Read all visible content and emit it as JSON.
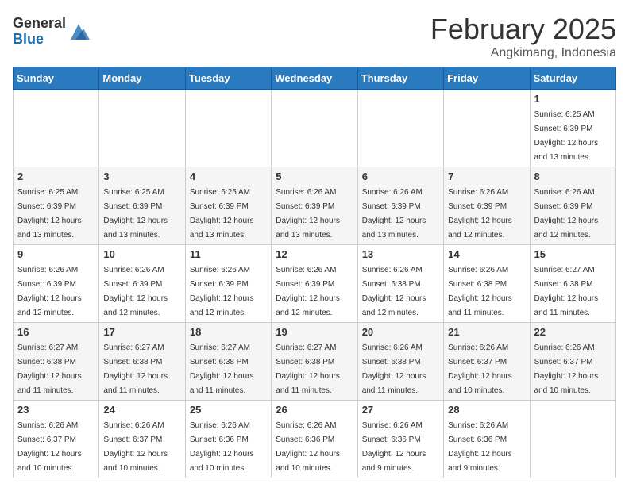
{
  "header": {
    "logo_general": "General",
    "logo_blue": "Blue",
    "month_title": "February 2025",
    "location": "Angkimang, Indonesia"
  },
  "days_of_week": [
    "Sunday",
    "Monday",
    "Tuesday",
    "Wednesday",
    "Thursday",
    "Friday",
    "Saturday"
  ],
  "weeks": [
    [
      {
        "day": "",
        "sunrise": "",
        "sunset": "",
        "daylight": ""
      },
      {
        "day": "",
        "sunrise": "",
        "sunset": "",
        "daylight": ""
      },
      {
        "day": "",
        "sunrise": "",
        "sunset": "",
        "daylight": ""
      },
      {
        "day": "",
        "sunrise": "",
        "sunset": "",
        "daylight": ""
      },
      {
        "day": "",
        "sunrise": "",
        "sunset": "",
        "daylight": ""
      },
      {
        "day": "",
        "sunrise": "",
        "sunset": "",
        "daylight": ""
      },
      {
        "day": "1",
        "sunrise": "Sunrise: 6:25 AM",
        "sunset": "Sunset: 6:39 PM",
        "daylight": "Daylight: 12 hours and 13 minutes."
      }
    ],
    [
      {
        "day": "2",
        "sunrise": "Sunrise: 6:25 AM",
        "sunset": "Sunset: 6:39 PM",
        "daylight": "Daylight: 12 hours and 13 minutes."
      },
      {
        "day": "3",
        "sunrise": "Sunrise: 6:25 AM",
        "sunset": "Sunset: 6:39 PM",
        "daylight": "Daylight: 12 hours and 13 minutes."
      },
      {
        "day": "4",
        "sunrise": "Sunrise: 6:25 AM",
        "sunset": "Sunset: 6:39 PM",
        "daylight": "Daylight: 12 hours and 13 minutes."
      },
      {
        "day": "5",
        "sunrise": "Sunrise: 6:26 AM",
        "sunset": "Sunset: 6:39 PM",
        "daylight": "Daylight: 12 hours and 13 minutes."
      },
      {
        "day": "6",
        "sunrise": "Sunrise: 6:26 AM",
        "sunset": "Sunset: 6:39 PM",
        "daylight": "Daylight: 12 hours and 13 minutes."
      },
      {
        "day": "7",
        "sunrise": "Sunrise: 6:26 AM",
        "sunset": "Sunset: 6:39 PM",
        "daylight": "Daylight: 12 hours and 12 minutes."
      },
      {
        "day": "8",
        "sunrise": "Sunrise: 6:26 AM",
        "sunset": "Sunset: 6:39 PM",
        "daylight": "Daylight: 12 hours and 12 minutes."
      }
    ],
    [
      {
        "day": "9",
        "sunrise": "Sunrise: 6:26 AM",
        "sunset": "Sunset: 6:39 PM",
        "daylight": "Daylight: 12 hours and 12 minutes."
      },
      {
        "day": "10",
        "sunrise": "Sunrise: 6:26 AM",
        "sunset": "Sunset: 6:39 PM",
        "daylight": "Daylight: 12 hours and 12 minutes."
      },
      {
        "day": "11",
        "sunrise": "Sunrise: 6:26 AM",
        "sunset": "Sunset: 6:39 PM",
        "daylight": "Daylight: 12 hours and 12 minutes."
      },
      {
        "day": "12",
        "sunrise": "Sunrise: 6:26 AM",
        "sunset": "Sunset: 6:39 PM",
        "daylight": "Daylight: 12 hours and 12 minutes."
      },
      {
        "day": "13",
        "sunrise": "Sunrise: 6:26 AM",
        "sunset": "Sunset: 6:38 PM",
        "daylight": "Daylight: 12 hours and 12 minutes."
      },
      {
        "day": "14",
        "sunrise": "Sunrise: 6:26 AM",
        "sunset": "Sunset: 6:38 PM",
        "daylight": "Daylight: 12 hours and 11 minutes."
      },
      {
        "day": "15",
        "sunrise": "Sunrise: 6:27 AM",
        "sunset": "Sunset: 6:38 PM",
        "daylight": "Daylight: 12 hours and 11 minutes."
      }
    ],
    [
      {
        "day": "16",
        "sunrise": "Sunrise: 6:27 AM",
        "sunset": "Sunset: 6:38 PM",
        "daylight": "Daylight: 12 hours and 11 minutes."
      },
      {
        "day": "17",
        "sunrise": "Sunrise: 6:27 AM",
        "sunset": "Sunset: 6:38 PM",
        "daylight": "Daylight: 12 hours and 11 minutes."
      },
      {
        "day": "18",
        "sunrise": "Sunrise: 6:27 AM",
        "sunset": "Sunset: 6:38 PM",
        "daylight": "Daylight: 12 hours and 11 minutes."
      },
      {
        "day": "19",
        "sunrise": "Sunrise: 6:27 AM",
        "sunset": "Sunset: 6:38 PM",
        "daylight": "Daylight: 12 hours and 11 minutes."
      },
      {
        "day": "20",
        "sunrise": "Sunrise: 6:26 AM",
        "sunset": "Sunset: 6:38 PM",
        "daylight": "Daylight: 12 hours and 11 minutes."
      },
      {
        "day": "21",
        "sunrise": "Sunrise: 6:26 AM",
        "sunset": "Sunset: 6:37 PM",
        "daylight": "Daylight: 12 hours and 10 minutes."
      },
      {
        "day": "22",
        "sunrise": "Sunrise: 6:26 AM",
        "sunset": "Sunset: 6:37 PM",
        "daylight": "Daylight: 12 hours and 10 minutes."
      }
    ],
    [
      {
        "day": "23",
        "sunrise": "Sunrise: 6:26 AM",
        "sunset": "Sunset: 6:37 PM",
        "daylight": "Daylight: 12 hours and 10 minutes."
      },
      {
        "day": "24",
        "sunrise": "Sunrise: 6:26 AM",
        "sunset": "Sunset: 6:37 PM",
        "daylight": "Daylight: 12 hours and 10 minutes."
      },
      {
        "day": "25",
        "sunrise": "Sunrise: 6:26 AM",
        "sunset": "Sunset: 6:36 PM",
        "daylight": "Daylight: 12 hours and 10 minutes."
      },
      {
        "day": "26",
        "sunrise": "Sunrise: 6:26 AM",
        "sunset": "Sunset: 6:36 PM",
        "daylight": "Daylight: 12 hours and 10 minutes."
      },
      {
        "day": "27",
        "sunrise": "Sunrise: 6:26 AM",
        "sunset": "Sunset: 6:36 PM",
        "daylight": "Daylight: 12 hours and 9 minutes."
      },
      {
        "day": "28",
        "sunrise": "Sunrise: 6:26 AM",
        "sunset": "Sunset: 6:36 PM",
        "daylight": "Daylight: 12 hours and 9 minutes."
      },
      {
        "day": "",
        "sunrise": "",
        "sunset": "",
        "daylight": ""
      }
    ]
  ]
}
